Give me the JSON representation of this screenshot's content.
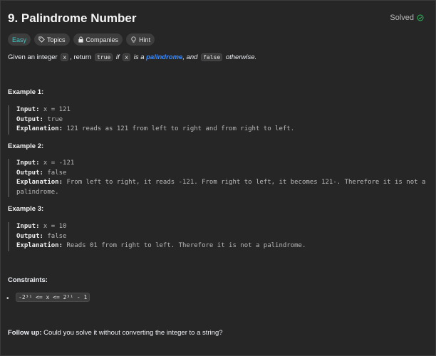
{
  "problem": {
    "title": "9. Palindrome Number",
    "status": "Solved",
    "status_color": "#2cbb5d"
  },
  "tags": {
    "difficulty": "Easy",
    "topics": "Topics",
    "companies": "Companies",
    "hint": "Hint",
    "difficulty_color": "#46c6c2"
  },
  "description": {
    "p1": "Given an integer ",
    "code_x": "x",
    "p2": ", return ",
    "code_true": "true",
    "p3": " if ",
    "code_x2": "x",
    "p4": " is a ",
    "link": "palindrome",
    "p5": ", and ",
    "code_false": "false",
    "p6": " otherwise.",
    "link_color": "#3b8cff"
  },
  "examples": [
    {
      "title": "Example 1:",
      "input_label": "Input:",
      "input": " x = 121",
      "output_label": "Output:",
      "output": " true",
      "explanation_label": "Explanation:",
      "explanation": " 121 reads as 121 from left to right and from right to left."
    },
    {
      "title": "Example 2:",
      "input_label": "Input:",
      "input": " x = -121",
      "output_label": "Output:",
      "output": " false",
      "explanation_label": "Explanation:",
      "explanation": " From left to right, it reads -121. From right to left, it becomes 121-. Therefore it is not a palindrome."
    },
    {
      "title": "Example 3:",
      "input_label": "Input:",
      "input": " x = 10",
      "output_label": "Output:",
      "output": " false",
      "explanation_label": "Explanation:",
      "explanation": " Reads 01 from right to left. Therefore it is not a palindrome."
    }
  ],
  "constraints": {
    "title": "Constraints:",
    "items": [
      "-2³¹ <= x <= 2³¹ - 1"
    ]
  },
  "followup": {
    "label": "Follow up:",
    "text": " Could you solve it without converting the integer to a string?"
  }
}
